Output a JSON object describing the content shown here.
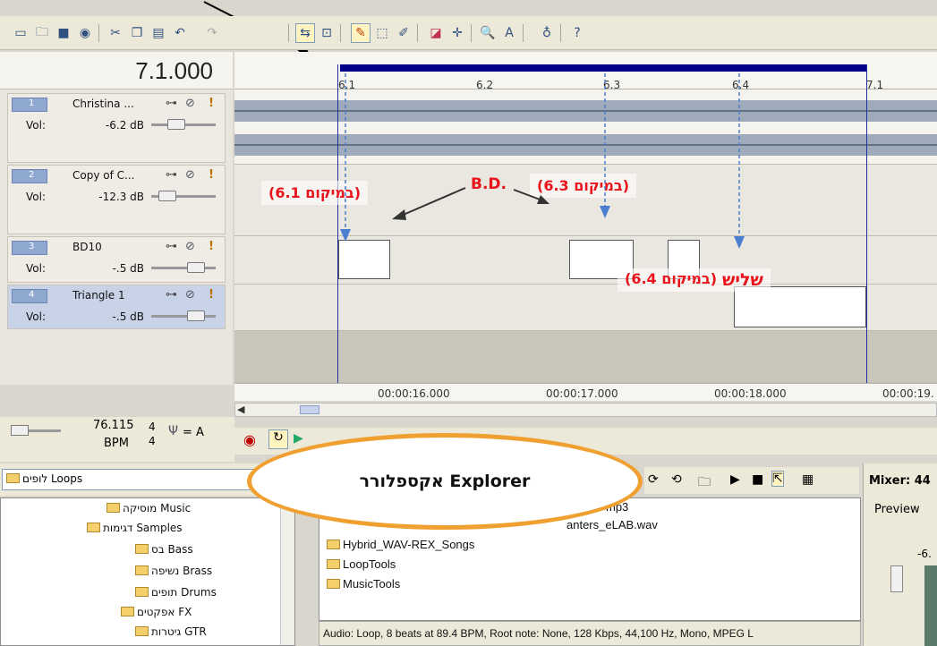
{
  "time_display": "7.1.000",
  "ruler_labels": [
    "6.1",
    "6.2",
    "6.3",
    "6.4",
    "7.1"
  ],
  "time_labels": [
    "00:00:16.000",
    "00:00:17.000",
    "00:00:18.000",
    "00:00:19."
  ],
  "tracks": [
    {
      "num": "1",
      "name": "Christina ...",
      "vol_label": "Vol:",
      "vol": "-6.2 dB"
    },
    {
      "num": "2",
      "name": "Copy of C...",
      "vol_label": "Vol:",
      "vol": "-12.3 dB"
    },
    {
      "num": "3",
      "name": "BD10",
      "vol_label": "Vol:",
      "vol": "-.5 dB"
    },
    {
      "num": "4",
      "name": "Triangle 1",
      "vol_label": "Vol:",
      "vol": "-.5 dB"
    }
  ],
  "bpm": {
    "value": "76.115",
    "label": "BPM",
    "sig_top": "4",
    "sig_bottom": "4",
    "tuning": "= A"
  },
  "explorer": {
    "path": "לופים Loops",
    "tree": [
      {
        "label": "מוסיקה Music"
      },
      {
        "label": "דגימות Samples"
      },
      {
        "label": "בס Bass"
      },
      {
        "label": "נשיפה Brass"
      },
      {
        "label": "תופים Drums"
      },
      {
        "label": "אפקטים FX"
      },
      {
        "label": "גיטרות GTR"
      }
    ],
    "files": [
      "mp3",
      "anters_eLAB.wav",
      "Hybrid_WAV-REX_Songs",
      "LoopTools",
      "MusicTools"
    ],
    "status": "Audio: Loop, 8 beats at 89.4 BPM, Root note: None, 128 Kbps, 44,100 Hz, Mono, MPEG L"
  },
  "mixer": {
    "title": "Mixer: 44",
    "preview": "Preview",
    "level": "-6."
  },
  "annotations": {
    "pos61": "(במיקום 6.1)",
    "pos63": "(במיקום 6.3)",
    "bd": "B.D.",
    "pos64_prefix": "שליש",
    "pos64": "(במיקום 6.4)",
    "explorer": "אקספלורר Explorer"
  },
  "colors": {
    "accent_red": "#e8131b",
    "ellipse_border": "#f0a030",
    "loop_bar": "#00008b"
  }
}
